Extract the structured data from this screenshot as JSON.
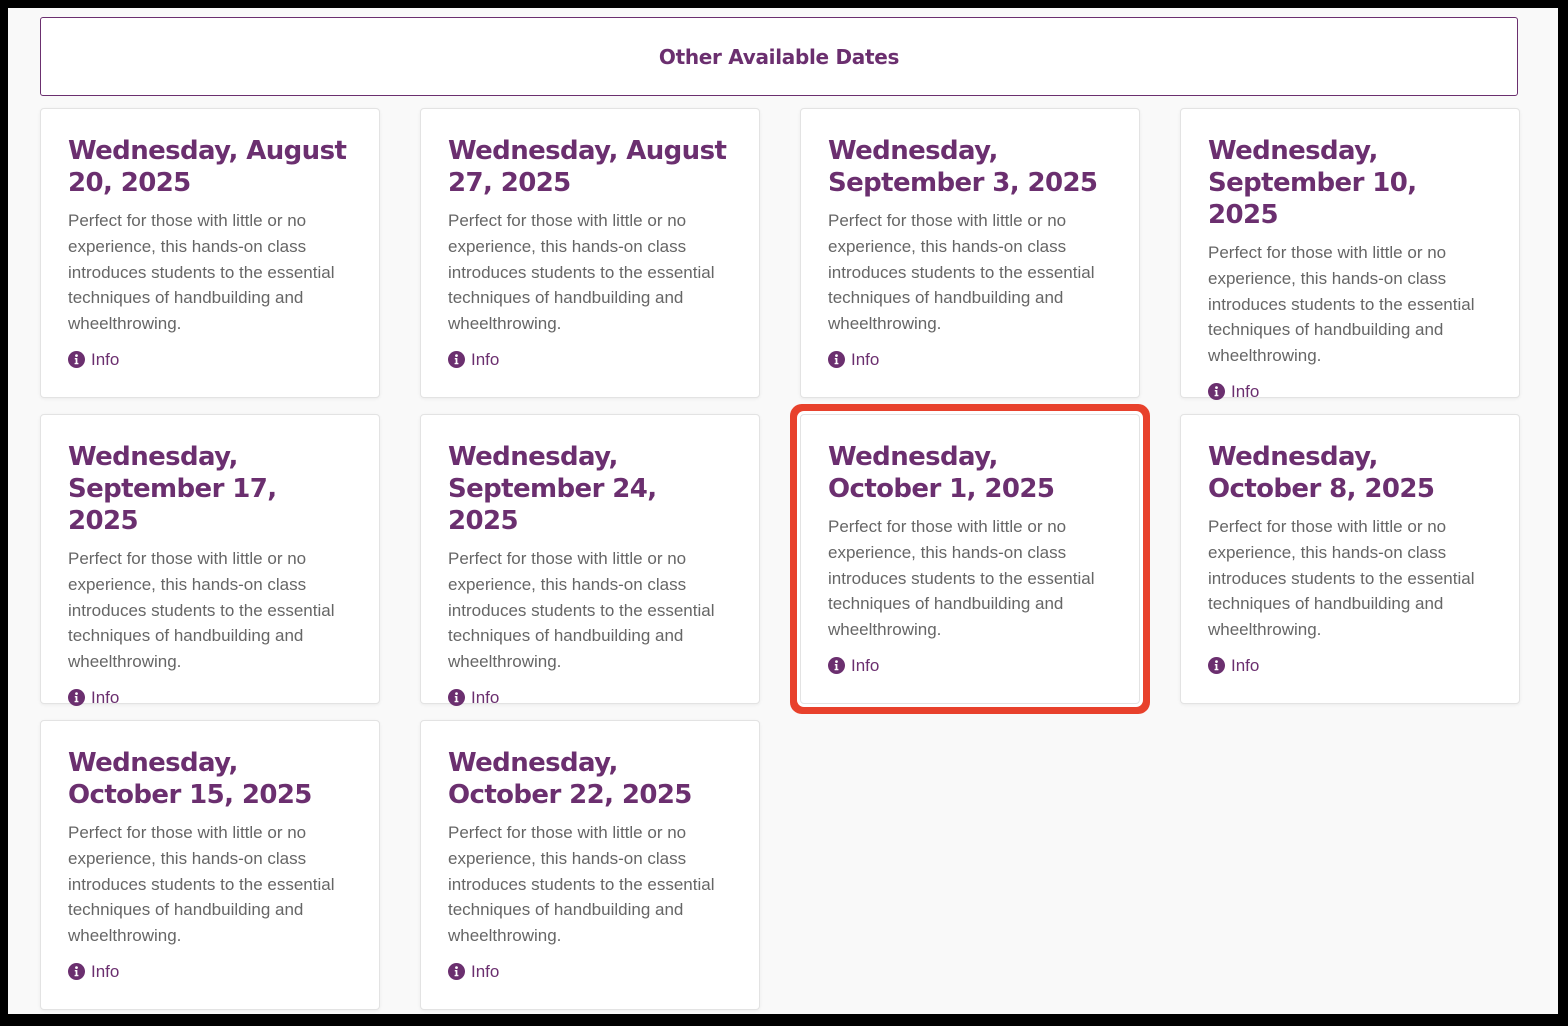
{
  "page": {
    "heading": "Other Available Dates"
  },
  "colors": {
    "brand": "#6b2f6f",
    "highlight": "#e8412c",
    "description_text": "#666666",
    "background": "#f9f9f9"
  },
  "cards": [
    {
      "date": "Wednesday, August 20, 2025",
      "description": "Perfect for those with little or no experience, this hands-on class introduces students to the essential techniques of handbuilding and wheelthrowing.",
      "info_label": "Info",
      "info_icon": "info-circle-icon"
    },
    {
      "date": "Wednesday, August 27, 2025",
      "description": "Perfect for those with little or no experience, this hands-on class introduces students to the essential techniques of handbuilding and wheelthrowing.",
      "info_label": "Info",
      "info_icon": "info-circle-icon"
    },
    {
      "date": "Wednesday, September 3, 2025",
      "description": "Perfect for those with little or no experience, this hands-on class introduces students to the essential techniques of handbuilding and wheelthrowing.",
      "info_label": "Info",
      "info_icon": "info-circle-icon"
    },
    {
      "date": "Wednesday, September 10, 2025",
      "description": "Perfect for those with little or no experience, this hands-on class introduces students to the essential techniques of handbuilding and wheelthrowing.",
      "info_label": "Info",
      "info_icon": "info-circle-icon"
    },
    {
      "date": "Wednesday, September 17, 2025",
      "description": "Perfect for those with little or no experience, this hands-on class introduces students to the essential techniques of handbuilding and wheelthrowing.",
      "info_label": "Info",
      "info_icon": "info-circle-icon"
    },
    {
      "date": "Wednesday, September 24, 2025",
      "description": "Perfect for those with little or no experience, this hands-on class introduces students to the essential techniques of handbuilding and wheelthrowing.",
      "info_label": "Info",
      "info_icon": "info-circle-icon"
    },
    {
      "date": "Wednesday, October 1, 2025",
      "description": "Perfect for those with little or no experience, this hands-on class introduces students to the essential techniques of handbuilding and wheelthrowing.",
      "info_label": "Info",
      "info_icon": "info-circle-icon",
      "highlighted": true
    },
    {
      "date": "Wednesday, October 8, 2025",
      "description": "Perfect for those with little or no experience, this hands-on class introduces students to the essential techniques of handbuilding and wheelthrowing.",
      "info_label": "Info",
      "info_icon": "info-circle-icon"
    },
    {
      "date": "Wednesday, October 15, 2025",
      "description": "Perfect for those with little or no experience, this hands-on class introduces students to the essential techniques of handbuilding and wheelthrowing.",
      "info_label": "Info",
      "info_icon": "info-circle-icon"
    },
    {
      "date": "Wednesday, October 22, 2025",
      "description": "Perfect for those with little or no experience, this hands-on class introduces students to the essential techniques of handbuilding and wheelthrowing.",
      "info_label": "Info",
      "info_icon": "info-circle-icon"
    }
  ]
}
